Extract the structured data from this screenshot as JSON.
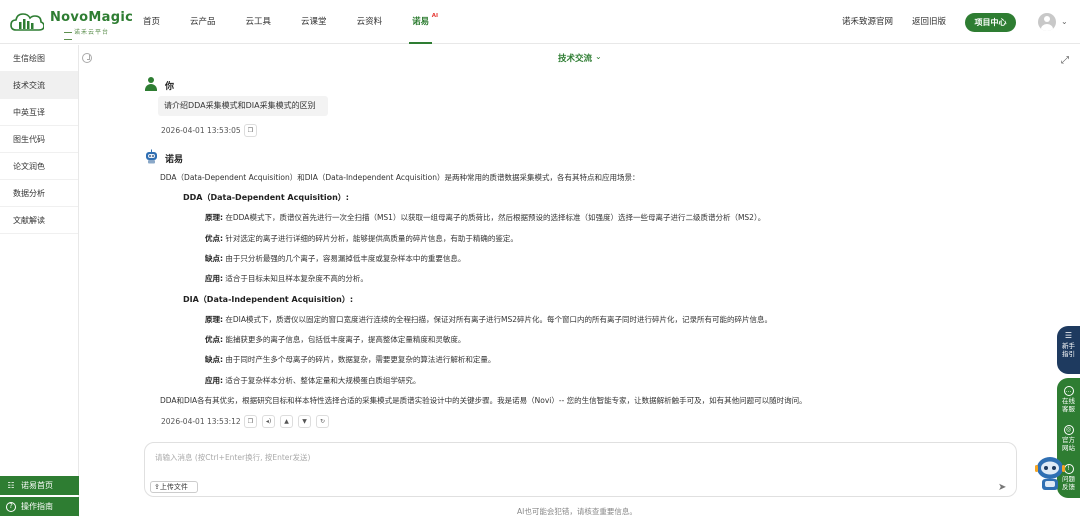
{
  "brand": {
    "name": "NovoMagic",
    "tagline": "诺禾云平台"
  },
  "nav": {
    "items": [
      "首页",
      "云产品",
      "云工具",
      "云课堂",
      "云资料",
      "诺易"
    ],
    "ai_badge": "AI",
    "official_site": "诺禾致源官网",
    "old_version": "返回旧版",
    "project_center": "项目中心"
  },
  "sidebar": {
    "items": [
      "生信绘图",
      "技术交流",
      "中英互译",
      "图生代码",
      "论文润色",
      "数据分析",
      "文献解读"
    ],
    "active_index": 1,
    "bottom": {
      "home": "诺易首页",
      "guide": "操作指南"
    }
  },
  "topic": "技术交流",
  "user": {
    "name": "你",
    "message": "请介绍DDA采集模式和DIA采集模式的区别",
    "timestamp": "2026-04-01 13:53:05"
  },
  "bot": {
    "name": "诺易",
    "intro": "DDA（Data-Dependent Acquisition）和DIA（Data-Independent Acquisition）是两种常用的质谱数据采集模式，各有其特点和应用场景：",
    "sections": [
      {
        "title": "DDA（Data-Dependent Acquisition）:",
        "points": [
          {
            "label": "原理:",
            "text": "在DDA模式下，质谱仪首先进行一次全扫描（MS1）以获取一组母离子的质荷比，然后根据预设的选择标准（如强度）选择一些母离子进行二级质谱分析（MS2）。"
          },
          {
            "label": "优点:",
            "text": "针对选定的离子进行详细的碎片分析，能够提供高质量的碎片信息，有助于精确的鉴定。"
          },
          {
            "label": "缺点:",
            "text": "由于只分析最强的几个离子，容易漏掉低丰度或复杂样本中的重要信息。"
          },
          {
            "label": "应用:",
            "text": "适合于目标未知且样本复杂度不高的分析。"
          }
        ]
      },
      {
        "title": "DIA（Data-Independent Acquisition）:",
        "points": [
          {
            "label": "原理:",
            "text": "在DIA模式下，质谱仪以固定的窗口宽度进行连续的全程扫描，保证对所有离子进行MS2碎片化。每个窗口内的所有离子同时进行碎片化，记录所有可能的碎片信息。"
          },
          {
            "label": "优点:",
            "text": "能捕获更多的离子信息，包括低丰度离子，提高整体定量精度和灵敏度。"
          },
          {
            "label": "缺点:",
            "text": "由于同时产生多个母离子的碎片，数据复杂，需要更复杂的算法进行解析和定量。"
          },
          {
            "label": "应用:",
            "text": "适合于复杂样本分析、整体定量和大规模蛋白质组学研究。"
          }
        ]
      }
    ],
    "conclusion": "DDA和DIA各有其优劣，根据研究目标和样本特性选择合适的采集模式是质谱实验设计中的关键步骤。我是诺易（Novi）-- 您的生信智能专家，让数据解析触手可及，如有其他问题可以随时询问。",
    "timestamp": "2026-04-01 13:53:12"
  },
  "input": {
    "placeholder": "请输入消息 (按Ctrl+Enter换行, 按Enter发送)",
    "upload_label": "上传文件"
  },
  "disclaimer": "AI也可能会犯错，请核查重要信息。",
  "floats": {
    "guide": "新手指引",
    "service": "在线客服",
    "website": "官方网站",
    "feedback": "问题反馈"
  },
  "colors": {
    "primary": "#2e7d32",
    "guide_bg": "#1e3a5f",
    "ai_badge": "#e53935"
  }
}
